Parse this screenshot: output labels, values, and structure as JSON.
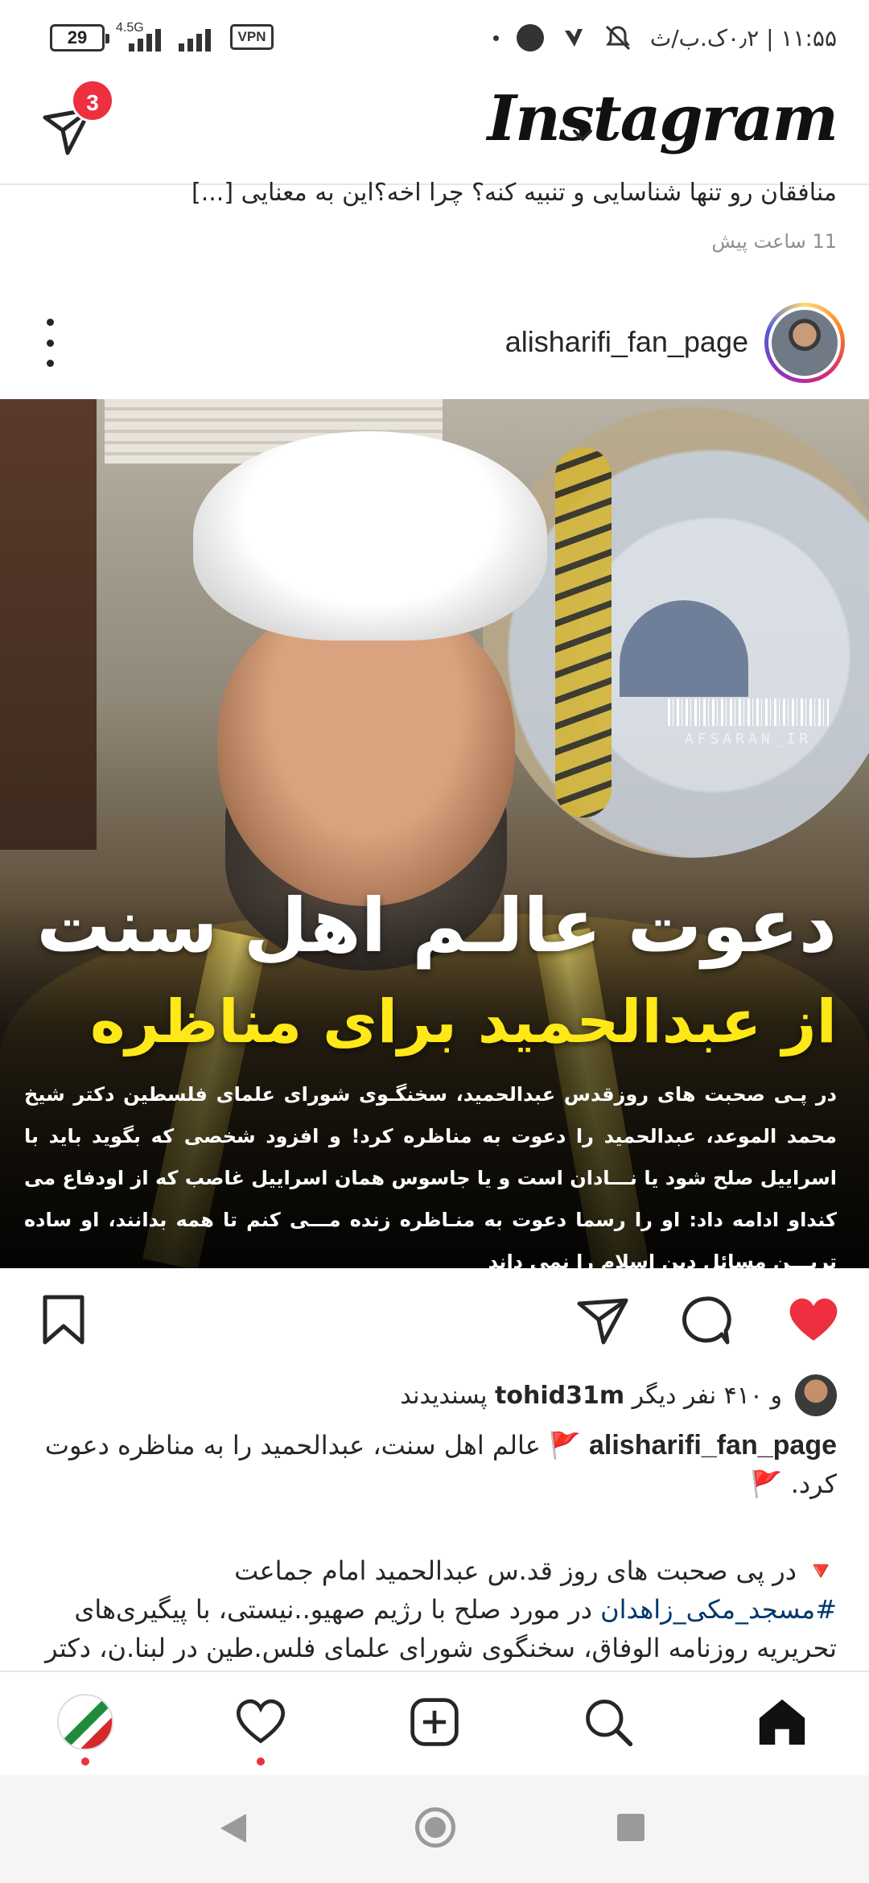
{
  "status_bar": {
    "battery": "29",
    "network_type": "4.5G",
    "vpn": "VPN",
    "right_text": "۱۱:۵۵ | ۰٫۲ک.ب/ث"
  },
  "header": {
    "logo": "Instagram",
    "direct_badge": "3"
  },
  "prev_post": {
    "caption": "منافقان رو تنها شناسایی و تنبیه کنه؟ چرا اخه؟این به معنایی [...]",
    "time": "11 ساعت پیش"
  },
  "post": {
    "username": "alisharifi_fan_page",
    "image": {
      "watermark": "AFSARAN_IR",
      "headline": "دعوت عالـم اهل سنت",
      "subheadline": "از عبدالحمید برای مناظره",
      "body": "در پـی صحبت های روزقدس عبدالحمید، سخنگـوی شورای علمای فلسطین دکتر شیخ محمد الموعد، عبدالحمید را دعوت به مناظره کرد! و افزود شخصی که بگوید باید با اسراییل صلح شود یا نـــادان است و یا جاسوس  همان اسراییل غاصب که از اودفاع می کنداو ادامه داد: او را رسما دعوت به منـاظره زنده مـــی کنم تا همه بدانند، او ساده تریـــن مسائل دین اسلام را نمی داند"
    },
    "likes": {
      "user": "tohid31m",
      "text": "پسندیدند",
      "others": "و ۴۱۰ نفر دیگر"
    },
    "caption": {
      "user": "alisharifi_fan_page",
      "flag": "🚩",
      "text": "عالم اهل سنت، عبدالحمید را به مناظره دعوت کرد.",
      "flag_end": "🚩"
    },
    "caption2": {
      "marker": "🔻",
      "line1": "در پی صحبت های روز قد.س عبدالحمید امام جماعت",
      "hashtag": "#مسجد_مکی_زاهدان",
      "line2": "در مورد صلح با رژیم صهیو..نیستی، با پیگیری‌های تحریریه روزنامه الوفاق، سخنگوی شورای علمای فلس.طین در لبنا.ن، دکتر"
    }
  },
  "colors": {
    "like_red": "#ed2f3f",
    "headline_yellow": "#ffe817",
    "hashtag_blue": "#00376b"
  }
}
